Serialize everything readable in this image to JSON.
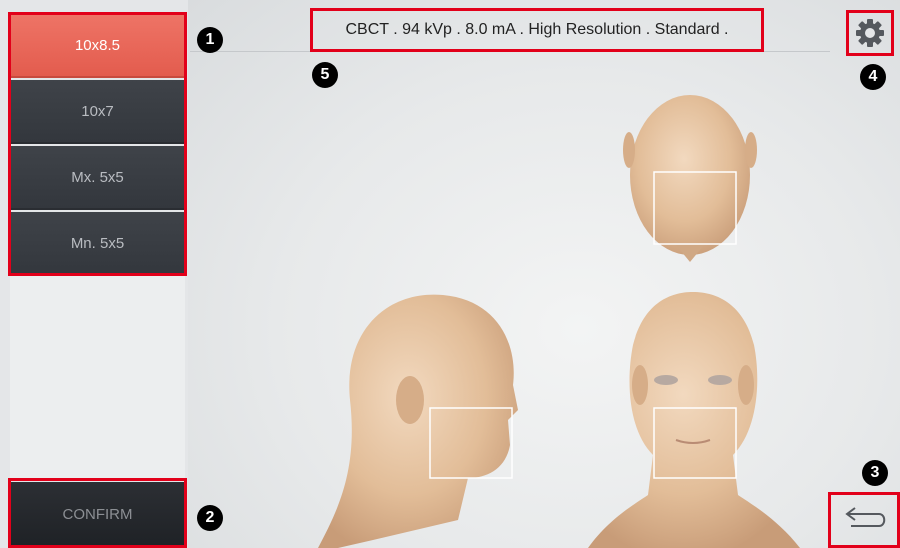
{
  "fov_options": [
    {
      "label": "10x8.5",
      "selected": true
    },
    {
      "label": "10x7",
      "selected": false
    },
    {
      "label": "Mx. 5x5",
      "selected": false
    },
    {
      "label": "Mn. 5x5",
      "selected": false
    }
  ],
  "confirm_label": "CONFIRM",
  "info_text": "CBCT . 94 kVp . 8.0 mA . High Resolution . Standard .",
  "badges": {
    "b1": "1",
    "b2": "2",
    "b3": "3",
    "b4": "4",
    "b5": "5"
  },
  "icons": {
    "settings": "gear-icon",
    "back": "back-arrow-icon"
  },
  "colors": {
    "selected": "#e35c4e",
    "button": "#3a3e44",
    "highlight_box": "#e2001a"
  }
}
